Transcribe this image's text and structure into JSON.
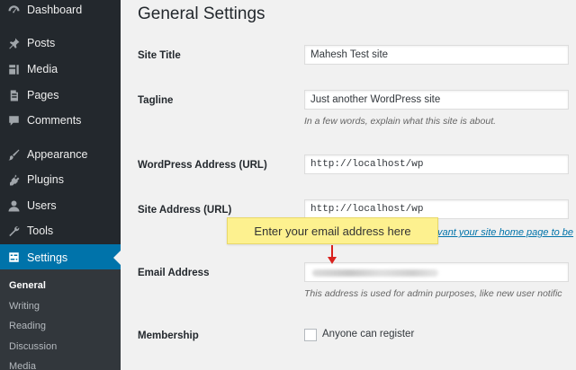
{
  "sidebar": {
    "items": [
      {
        "label": "Dashboard",
        "icon": "dashboard-icon"
      },
      {
        "label": "Posts",
        "icon": "pin-icon"
      },
      {
        "label": "Media",
        "icon": "media-icon"
      },
      {
        "label": "Pages",
        "icon": "pages-icon"
      },
      {
        "label": "Comments",
        "icon": "comment-icon"
      },
      {
        "label": "Appearance",
        "icon": "brush-icon"
      },
      {
        "label": "Plugins",
        "icon": "plugin-icon"
      },
      {
        "label": "Users",
        "icon": "user-icon"
      },
      {
        "label": "Tools",
        "icon": "wrench-icon"
      },
      {
        "label": "Settings",
        "icon": "settings-icon",
        "active": true
      }
    ],
    "submenu": [
      {
        "label": "General",
        "current": true
      },
      {
        "label": "Writing"
      },
      {
        "label": "Reading"
      },
      {
        "label": "Discussion"
      },
      {
        "label": "Media"
      }
    ]
  },
  "page": {
    "title": "General Settings"
  },
  "fields": {
    "site_title": {
      "label": "Site Title",
      "value": "Mahesh Test site"
    },
    "tagline": {
      "label": "Tagline",
      "value": "Just another WordPress site",
      "description": "In a few words, explain what this site is about."
    },
    "wp_address": {
      "label": "WordPress Address (URL)",
      "value": "http://localhost/wp"
    },
    "site_address": {
      "label": "Site Address (URL)",
      "value": "http://localhost/wp",
      "link_text": "vant your site home page to be"
    },
    "email": {
      "label": "Email Address",
      "description": "This address is used for admin purposes, like new user notific"
    },
    "membership": {
      "label": "Membership",
      "checkbox_label": "Anyone can register",
      "checked": false
    }
  },
  "annotation": {
    "text": "Enter your email address here",
    "color": "#fdf18f",
    "arrow_color": "#d9211d"
  },
  "colors": {
    "sidebar_bg": "#23282d",
    "active_bg": "#0073aa",
    "content_bg": "#f1f1f1"
  }
}
